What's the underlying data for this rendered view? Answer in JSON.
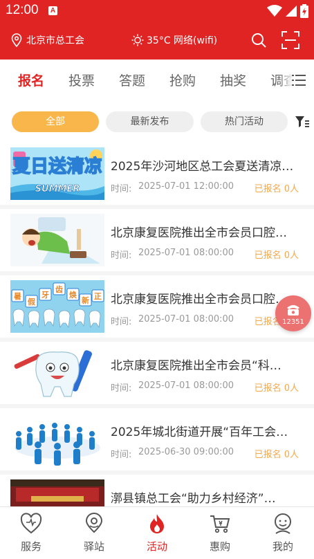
{
  "status_bar": {
    "time": "12:00",
    "notification_icon": "A"
  },
  "header": {
    "location": "北京市总工会",
    "weather": "35°C 网络(wifi)"
  },
  "tabs": [
    {
      "label": "报名",
      "active": true
    },
    {
      "label": "投票",
      "active": false
    },
    {
      "label": "答题",
      "active": false
    },
    {
      "label": "抢购",
      "active": false
    },
    {
      "label": "抽奖",
      "active": false
    },
    {
      "label": "调查",
      "active": false
    }
  ],
  "filters": [
    {
      "label": "全部",
      "active": true
    },
    {
      "label": "最新发布",
      "active": false
    },
    {
      "label": "热门活动",
      "active": false
    }
  ],
  "time_label": "时间:",
  "items": [
    {
      "title": "2025年沙河地区总工会夏送清凉…",
      "time": "2025-07-01 12:00:00",
      "registered": "已报名 0人",
      "thumb_text": "夏日送清凉",
      "thumb_sub": "SUMMER"
    },
    {
      "title": "北京康复医院推出全市会员口腔…",
      "time": "2025-07-01 08:00:00",
      "registered": "已报名 0人"
    },
    {
      "title": "北京康复医院推出全市会员口腔…",
      "time": "2025-07-01 08:00:00",
      "registered": "已报名 0人",
      "thumb_chars": [
        "暑",
        "假",
        "牙",
        "齿",
        "焕",
        "新",
        "正"
      ]
    },
    {
      "title": "北京康复医院推出全市会员“科…",
      "time": "2025-07-01 08:00:00",
      "registered": "已报名 0人"
    },
    {
      "title": "2025年城北街道开展“百年工会…",
      "time": "2025-06-30 09:00:00",
      "registered": "已报名 0人"
    },
    {
      "title": "漷县镇总工会“助力乡村经济”…",
      "time": "",
      "registered": ""
    }
  ],
  "hotline": {
    "number": "12351"
  },
  "bottom_nav": [
    {
      "label": "服务",
      "icon": "heart-icon",
      "active": false
    },
    {
      "label": "驿站",
      "icon": "station-icon",
      "active": false
    },
    {
      "label": "活动",
      "icon": "flame-icon",
      "active": true
    },
    {
      "label": "惠购",
      "icon": "cart-icon",
      "active": false
    },
    {
      "label": "我的",
      "icon": "user-icon",
      "active": false
    }
  ],
  "colors": {
    "primary": "#e02424",
    "accent": "#f8b64b",
    "registered": "#f6a94a"
  }
}
